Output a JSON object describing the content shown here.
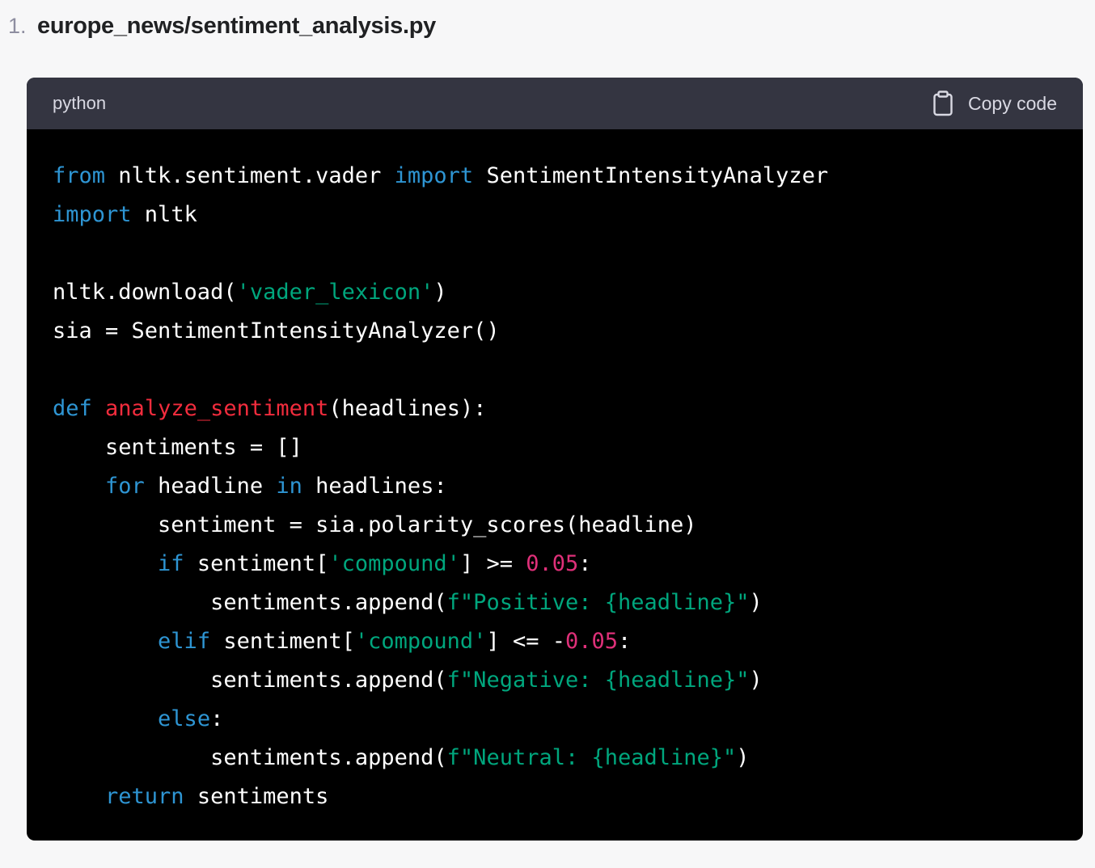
{
  "heading": {
    "list_number": "1.",
    "file_path": "europe_news/sentiment_analysis.py"
  },
  "code_block": {
    "language": "python",
    "copy_label": "Copy code",
    "icons": {
      "copy": "clipboard-icon"
    },
    "colors": {
      "background": "#000000",
      "header": "#343541",
      "keyword": "#2e95d3",
      "function": "#f22c3d",
      "string": "#00a67d",
      "number": "#df3079",
      "text": "#ffffff"
    },
    "lines": [
      [
        {
          "t": "kw",
          "v": "from"
        },
        {
          "t": "tx",
          "v": " nltk.sentiment.vader "
        },
        {
          "t": "kw",
          "v": "import"
        },
        {
          "t": "tx",
          "v": " SentimentIntensityAnalyzer"
        }
      ],
      [
        {
          "t": "kw",
          "v": "import"
        },
        {
          "t": "tx",
          "v": " nltk"
        }
      ],
      [],
      [
        {
          "t": "tx",
          "v": "nltk.download("
        },
        {
          "t": "str",
          "v": "'vader_lexicon'"
        },
        {
          "t": "tx",
          "v": ")"
        }
      ],
      [
        {
          "t": "tx",
          "v": "sia = SentimentIntensityAnalyzer()"
        }
      ],
      [],
      [
        {
          "t": "kw",
          "v": "def"
        },
        {
          "t": "tx",
          "v": " "
        },
        {
          "t": "fn",
          "v": "analyze_sentiment"
        },
        {
          "t": "tx",
          "v": "(headlines):"
        }
      ],
      [
        {
          "t": "tx",
          "v": "    sentiments = []"
        }
      ],
      [
        {
          "t": "tx",
          "v": "    "
        },
        {
          "t": "kw",
          "v": "for"
        },
        {
          "t": "tx",
          "v": " headline "
        },
        {
          "t": "kw",
          "v": "in"
        },
        {
          "t": "tx",
          "v": " headlines:"
        }
      ],
      [
        {
          "t": "tx",
          "v": "        sentiment = sia.polarity_scores(headline)"
        }
      ],
      [
        {
          "t": "tx",
          "v": "        "
        },
        {
          "t": "kw",
          "v": "if"
        },
        {
          "t": "tx",
          "v": " sentiment["
        },
        {
          "t": "str",
          "v": "'compound'"
        },
        {
          "t": "tx",
          "v": "] >= "
        },
        {
          "t": "num",
          "v": "0.05"
        },
        {
          "t": "tx",
          "v": ":"
        }
      ],
      [
        {
          "t": "tx",
          "v": "            sentiments.append("
        },
        {
          "t": "str",
          "v": "f\"Positive: {headline}\""
        },
        {
          "t": "tx",
          "v": ")"
        }
      ],
      [
        {
          "t": "tx",
          "v": "        "
        },
        {
          "t": "kw",
          "v": "elif"
        },
        {
          "t": "tx",
          "v": " sentiment["
        },
        {
          "t": "str",
          "v": "'compound'"
        },
        {
          "t": "tx",
          "v": "] <= -"
        },
        {
          "t": "num",
          "v": "0.05"
        },
        {
          "t": "tx",
          "v": ":"
        }
      ],
      [
        {
          "t": "tx",
          "v": "            sentiments.append("
        },
        {
          "t": "str",
          "v": "f\"Negative: {headline}\""
        },
        {
          "t": "tx",
          "v": ")"
        }
      ],
      [
        {
          "t": "tx",
          "v": "        "
        },
        {
          "t": "kw",
          "v": "else"
        },
        {
          "t": "tx",
          "v": ":"
        }
      ],
      [
        {
          "t": "tx",
          "v": "            sentiments.append("
        },
        {
          "t": "str",
          "v": "f\"Neutral: {headline}\""
        },
        {
          "t": "tx",
          "v": ")"
        }
      ],
      [
        {
          "t": "tx",
          "v": "    "
        },
        {
          "t": "kw",
          "v": "return"
        },
        {
          "t": "tx",
          "v": " sentiments"
        }
      ]
    ]
  }
}
